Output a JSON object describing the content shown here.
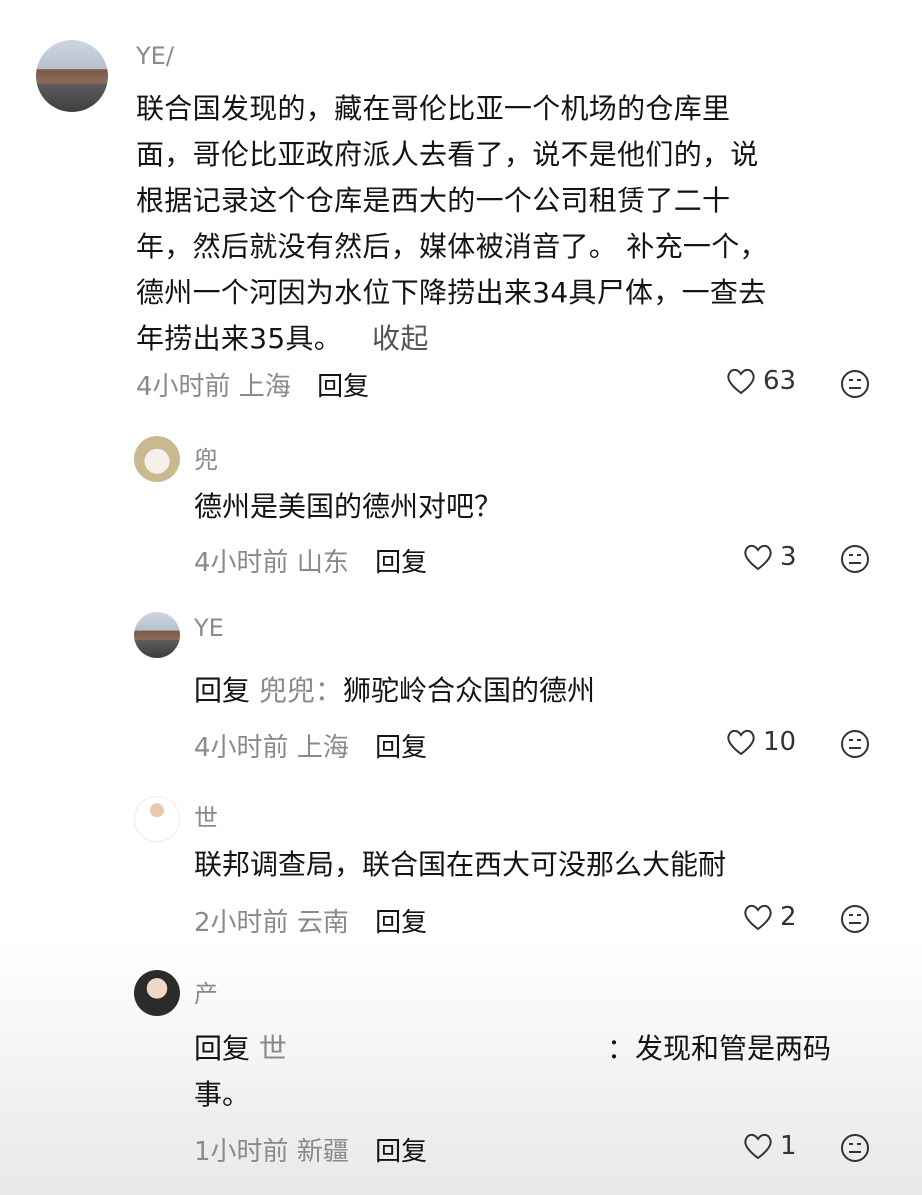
{
  "comments": [
    {
      "user": "YE/",
      "text": "联合国发现的，藏在哥伦比亚一个机场的仓库里\n面，哥伦比亚政府派人去看了，说不是他们的，说\n根据记录这个仓库是西大的一个公司租赁了二十\n年，然后就没有然后，媒体被消音了。 补充一个，\n德州一个河因为水位下降捞出来34具尸体，一查去\n年捞出来35具。",
      "collapse_label": "收起",
      "time": "4小时前",
      "location": "上海",
      "reply_label": "回复",
      "likes": "63"
    }
  ],
  "replies": [
    {
      "user": "兜",
      "text": "德州是美国的德州对吧？",
      "time": "4小时前",
      "location": "山东",
      "reply_label": "回复",
      "likes": "3"
    },
    {
      "user": "YE",
      "reply_prefix": "回复",
      "reply_target": "兜兜：",
      "text": "狮驼岭合众国的德州",
      "time": "4小时前",
      "location": "上海",
      "reply_label": "回复",
      "likes": "10"
    },
    {
      "user": "世",
      "text": "联邦调查局，联合国在西大可没那么大能耐",
      "time": "2小时前",
      "location": "云南",
      "reply_label": "回复",
      "likes": "2"
    },
    {
      "user": "产",
      "reply_prefix": "回复",
      "reply_target": "世",
      "reply_target_suffix": "：",
      "text": "发现和管是两码\n事。",
      "time": "1小时前",
      "location": "新疆",
      "reply_label": "回复",
      "likes": "1"
    }
  ],
  "icons": {
    "like": "heart-outline-icon",
    "emoji": "neutral-face-icon"
  },
  "colors": {
    "primary_text": "#141414",
    "secondary_text": "#8a8a8a"
  }
}
